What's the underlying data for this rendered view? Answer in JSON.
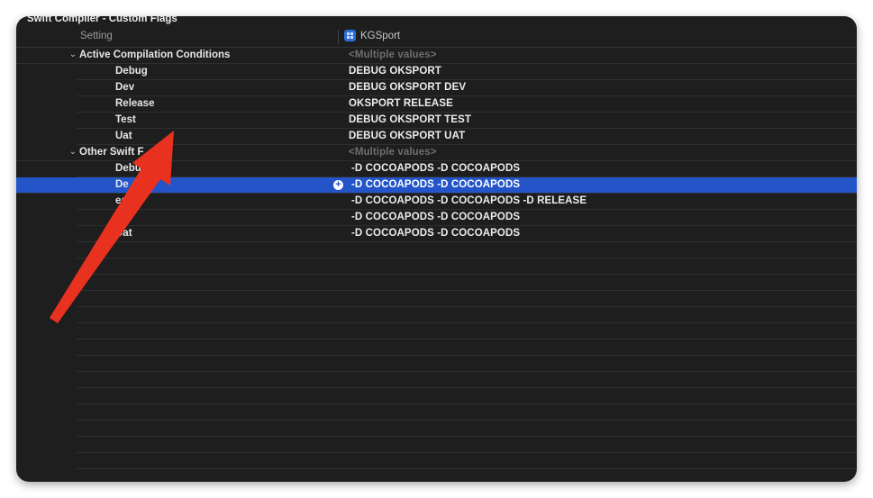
{
  "section_title": "Swift Compiler - Custom Flags",
  "header": {
    "setting_label": "Setting",
    "target_name": "KGSport"
  },
  "groups": {
    "active": {
      "title": "Active Compilation Conditions",
      "value": "<Multiple values>",
      "rows": [
        {
          "label": "Debug",
          "value": "DEBUG  OKSPORT"
        },
        {
          "label": "Dev",
          "value": "DEBUG  OKSPORT DEV"
        },
        {
          "label": "Release",
          "value": "OKSPORT RELEASE"
        },
        {
          "label": "Test",
          "value": "DEBUG  OKSPORT TEST"
        },
        {
          "label": "Uat",
          "value": "DEBUG  OKSPORT UAT"
        }
      ]
    },
    "other": {
      "title": "Other Swift F",
      "value": "<Multiple values>",
      "rows": [
        {
          "label": "Debu",
          "value": "-D COCOAPODS -D COCOAPODS"
        },
        {
          "label": "De",
          "value": "-D COCOAPODS -D COCOAPODS"
        },
        {
          "label": "ease",
          "value": "-D COCOAPODS -D COCOAPODS -D RELEASE"
        },
        {
          "label": "est",
          "value": "-D COCOAPODS -D COCOAPODS"
        },
        {
          "label": "Uat",
          "value": "-D COCOAPODS -D COCOAPODS"
        }
      ]
    }
  },
  "colors": {
    "selection": "#2455c8",
    "arrow": "#e8311f",
    "background": "#1e1e1e"
  },
  "icons": {
    "disclosure": "chevron-down-icon",
    "add": "plus-circle-icon",
    "target": "app-target-icon"
  }
}
